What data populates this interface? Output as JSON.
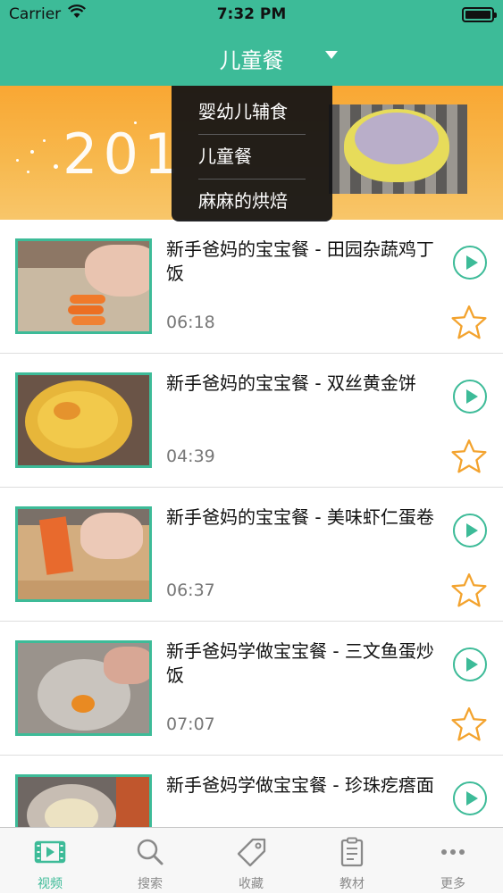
{
  "status_bar": {
    "carrier": "Carrier",
    "time": "7:32 PM"
  },
  "nav": {
    "title": "儿童餐"
  },
  "banner": {
    "text": "201"
  },
  "dropdown": {
    "items": [
      "婴幼儿辅食",
      "儿童餐",
      "麻麻的烘焙"
    ]
  },
  "videos": [
    {
      "title": "新手爸妈的宝宝餐 - 田园杂蔬鸡丁饭",
      "duration": "06:18"
    },
    {
      "title": "新手爸妈的宝宝餐 - 双丝黄金饼",
      "duration": "04:39"
    },
    {
      "title": "新手爸妈的宝宝餐 - 美味虾仁蛋卷",
      "duration": "06:37"
    },
    {
      "title": "新手爸妈学做宝宝餐 - 三文鱼蛋炒饭",
      "duration": "07:07"
    },
    {
      "title": "新手爸妈学做宝宝餐 - 珍珠疙瘩面",
      "duration": ""
    }
  ],
  "tabbar": {
    "tabs": [
      {
        "label": "视频",
        "icon": "film-icon",
        "active": true
      },
      {
        "label": "搜索",
        "icon": "search-icon",
        "active": false
      },
      {
        "label": "收藏",
        "icon": "tag-icon",
        "active": false
      },
      {
        "label": "教材",
        "icon": "clipboard-icon",
        "active": false
      },
      {
        "label": "更多",
        "icon": "more-icon",
        "active": false
      }
    ]
  },
  "colors": {
    "accent": "#3dbb98",
    "banner": "#f9a733",
    "dropdown": "#121214"
  }
}
